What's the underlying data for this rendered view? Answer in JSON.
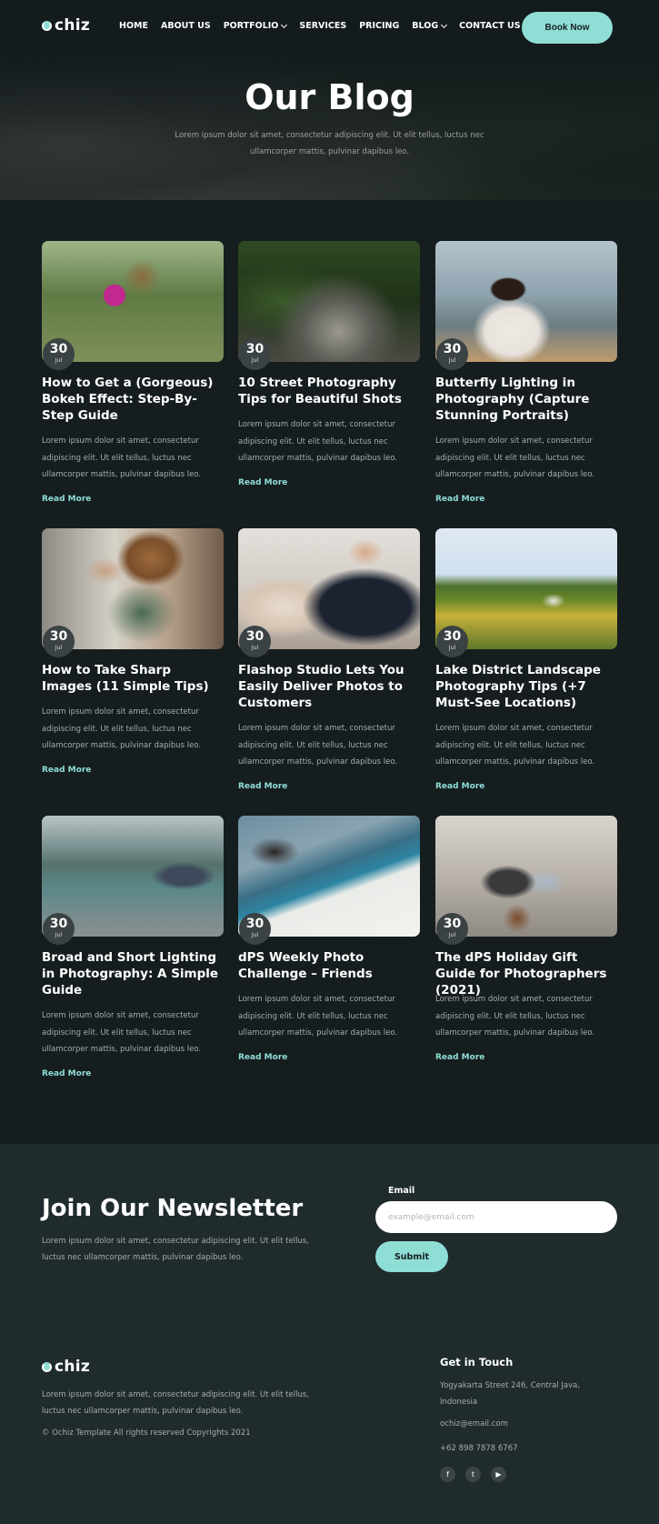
{
  "header": {
    "logo_text": "chiz",
    "nav": [
      {
        "label": "HOME",
        "has_dropdown": false
      },
      {
        "label": "ABOUT US",
        "has_dropdown": false
      },
      {
        "label": "PORTFOLIO",
        "has_dropdown": true
      },
      {
        "label": "SERVICES",
        "has_dropdown": false
      },
      {
        "label": "PRICING",
        "has_dropdown": false
      },
      {
        "label": "BLOG",
        "has_dropdown": true
      },
      {
        "label": "CONTACT US",
        "has_dropdown": false
      }
    ],
    "cta_label": "Book Now"
  },
  "hero": {
    "title": "Our Blog",
    "subtitle": "Lorem ipsum dolor sit amet, consectetur adipiscing elit. Ut elit tellus, luctus nec ullamcorper mattis, pulvinar dapibus leo."
  },
  "posts": [
    {
      "day": "30",
      "month": "Jul",
      "title": "How to Get a (Gorgeous) Bokeh Effect: Step-By-Step Guide",
      "excerpt": "Lorem ipsum dolor sit amet, consectetur adipiscing elit. Ut elit tellus, luctus nec ullamcorper mattis, pulvinar dapibus leo.",
      "read_more": "Read More"
    },
    {
      "day": "30",
      "month": "Jul",
      "title": "10 Street Photography Tips for Beautiful Shots",
      "excerpt": "Lorem ipsum dolor sit amet, consectetur adipiscing elit. Ut elit tellus, luctus nec ullamcorper mattis, pulvinar dapibus leo.",
      "read_more": "Read More"
    },
    {
      "day": "30",
      "month": "Jul",
      "title": "Butterfly Lighting in Photography (Capture Stunning Portraits)",
      "excerpt": "Lorem ipsum dolor sit amet, consectetur adipiscing elit. Ut elit tellus, luctus nec ullamcorper mattis, pulvinar dapibus leo.",
      "read_more": "Read More"
    },
    {
      "day": "30",
      "month": "Jul",
      "title": "How to Take Sharp Images (11 Simple Tips)",
      "excerpt": "Lorem ipsum dolor sit amet, consectetur adipiscing elit. Ut elit tellus, luctus nec ullamcorper mattis, pulvinar dapibus leo.",
      "read_more": "Read More"
    },
    {
      "day": "30",
      "month": "Jul",
      "title": "Flashop Studio Lets You Easily Deliver Photos to Customers",
      "excerpt": "Lorem ipsum dolor sit amet, consectetur adipiscing elit. Ut elit tellus, luctus nec ullamcorper mattis, pulvinar dapibus leo.",
      "read_more": "Read More"
    },
    {
      "day": "30",
      "month": "Jul",
      "title": "Lake District Landscape Photography Tips (+7 Must-See Locations)",
      "excerpt": "Lorem ipsum dolor sit amet, consectetur adipiscing elit. Ut elit tellus, luctus nec ullamcorper mattis, pulvinar dapibus leo.",
      "read_more": "Read More"
    },
    {
      "day": "30",
      "month": "Jul",
      "title": "Broad and Short Lighting in Photography: A Simple Guide",
      "excerpt": "Lorem ipsum dolor sit amet, consectetur adipiscing elit. Ut elit tellus, luctus nec ullamcorper mattis, pulvinar dapibus leo.",
      "read_more": "Read More"
    },
    {
      "day": "30",
      "month": "Jul",
      "title": "dPS Weekly Photo Challenge – Friends",
      "excerpt": "Lorem ipsum dolor sit amet, consectetur adipiscing elit. Ut elit tellus, luctus nec ullamcorper mattis, pulvinar dapibus leo.",
      "read_more": "Read More"
    },
    {
      "day": "30",
      "month": "Jul",
      "title": "The dPS Holiday Gift Guide for Photographers (2021)",
      "excerpt": "Lorem ipsum dolor sit amet, consectetur adipiscing elit. Ut elit tellus, luctus nec ullamcorper mattis, pulvinar dapibus leo.",
      "read_more": "Read More"
    }
  ],
  "newsletter": {
    "title": "Join Our Newsletter",
    "text": "Lorem ipsum dolor sit amet, consectetur adipiscing elit. Ut elit tellus, luctus nec ullamcorper mattis, pulvinar dapibus leo.",
    "email_label": "Email",
    "email_placeholder": "example@email.com",
    "email_value": "",
    "submit_label": "Submit"
  },
  "footer": {
    "logo_text": "chiz",
    "text": "Lorem ipsum dolor sit amet, consectetur adipiscing elit. Ut elit tellus, luctus nec ullamcorper mattis, pulvinar dapibus leo.",
    "copyright": "© Ochiz Template All rights reserved Copyrights 2021",
    "contact_title": "Get in Touch",
    "address": "Yogyakarta Street 246, Central Java, Indonesia",
    "email": "ochiz@email.com",
    "phone": "+62 898 7878 6767",
    "socials": [
      {
        "icon": "facebook-icon",
        "glyph": "f"
      },
      {
        "icon": "twitter-icon",
        "glyph": "t"
      },
      {
        "icon": "youtube-icon",
        "glyph": "▶"
      }
    ]
  },
  "colors": {
    "accent": "#8fded6",
    "background": "#161d1f",
    "panel": "#202b2e"
  }
}
